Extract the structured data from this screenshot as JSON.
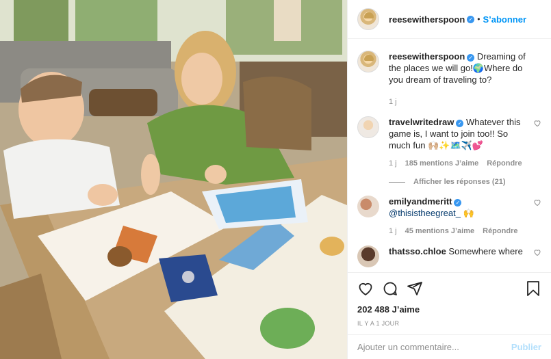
{
  "post": {
    "photo_alt": "Photo",
    "author": "reesewitherspoon",
    "follow_label": "S’abonner",
    "caption": "Dreaming of the places we will go!🌍Where do you dream of traveling to?",
    "caption_time": "1 j"
  },
  "comments": [
    {
      "user": "travelwritedraw",
      "verified": true,
      "text": "Whatever this game is, I want to join too!! So much fun 🙌🏼✨🗺️✈️💕",
      "time": "1 j",
      "likes": "185 mentions J’aime",
      "reply": "Répondre",
      "view_replies": "Afficher les réponses (21)"
    },
    {
      "user": "emilyandmeritt",
      "verified": true,
      "text": "@thisistheegreat_ 🙌",
      "time": "1 j",
      "likes": "45 mentions J’aime",
      "reply": "Répondre"
    },
    {
      "user": "thatsso.chloe",
      "verified": false,
      "text": "Somewhere where"
    }
  ],
  "actions": {
    "like_count": "202 488 J’aime",
    "posted_ago": "IL Y A 1 JOUR"
  },
  "composer": {
    "placeholder": "Ajouter un commentaire...",
    "publish_label": "Publier"
  },
  "icons": [
    "heart-icon",
    "comment-icon",
    "share-icon",
    "bookmark-icon",
    "verified-icon"
  ],
  "colors": {
    "accent": "#0095f6",
    "verified": "#3897f0",
    "muted": "#8e8e8e"
  }
}
